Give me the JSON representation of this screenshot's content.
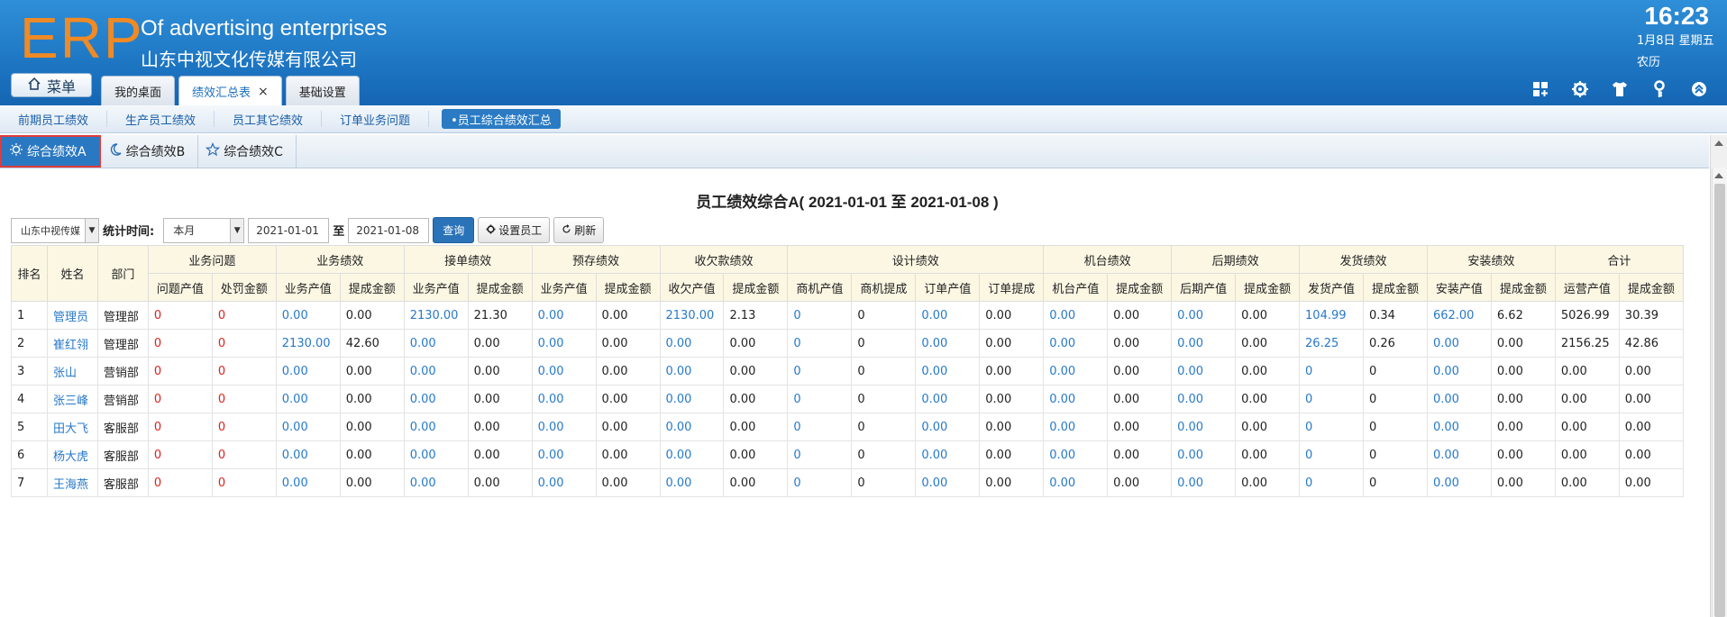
{
  "header": {
    "logo": "ERP",
    "company_en": "Of advertising enterprises",
    "company_cn": "山东中视文化传媒有限公司",
    "time": "16:23",
    "date": "1月8日 星期五",
    "lunar": "农历",
    "menu_label": "菜单",
    "tabs": [
      {
        "label": "我的桌面"
      },
      {
        "label": "绩效汇总表",
        "close": "×"
      },
      {
        "label": "基础设置"
      }
    ]
  },
  "subnav": [
    "前期员工绩效",
    "生产员工绩效",
    "员工其它绩效",
    "订单业务问题",
    "•员工综合绩效汇总"
  ],
  "inner_tabs": [
    "综合绩效A",
    "综合绩效B",
    "综合绩效C"
  ],
  "report": {
    "title": "员工绩效综合A( 2021-01-01 至 2021-01-08 )",
    "company_select": "山东中视传媒",
    "time_label": "统计时间:",
    "period_select": "本月",
    "date_from": "2021-01-01",
    "to_label": "至",
    "date_to": "2021-01-08",
    "query_btn": "查询",
    "set_staff_btn": "设置员工",
    "refresh_btn": "刷新"
  },
  "table": {
    "fixed_headers": [
      "排名",
      "姓名",
      "部门"
    ],
    "groups": [
      {
        "name": "业务问题",
        "cols": [
          "问题产值",
          "处罚金额"
        ]
      },
      {
        "name": "业务绩效",
        "cols": [
          "业务产值",
          "提成金额"
        ]
      },
      {
        "name": "接单绩效",
        "cols": [
          "业务产值",
          "提成金额"
        ]
      },
      {
        "name": "预存绩效",
        "cols": [
          "业务产值",
          "提成金额"
        ]
      },
      {
        "name": "收欠款绩效",
        "cols": [
          "收欠产值",
          "提成金额"
        ]
      },
      {
        "name": "设计绩效",
        "cols": [
          "商机产值",
          "商机提成",
          "订单产值",
          "订单提成"
        ]
      },
      {
        "name": "机台绩效",
        "cols": [
          "机台产值",
          "提成金额"
        ]
      },
      {
        "name": "后期绩效",
        "cols": [
          "后期产值",
          "提成金额"
        ]
      },
      {
        "name": "发货绩效",
        "cols": [
          "发货产值",
          "提成金额"
        ]
      },
      {
        "name": "安装绩效",
        "cols": [
          "安装产值",
          "提成金额"
        ]
      },
      {
        "name": "合计",
        "cols": [
          "运营产值",
          "提成金额"
        ]
      }
    ],
    "rows": [
      [
        "1",
        "管理员",
        "管理部",
        "0",
        "0",
        "0.00",
        "0.00",
        "2130.00",
        "21.30",
        "0.00",
        "0.00",
        "2130.00",
        "2.13",
        "0",
        "0",
        "0.00",
        "0.00",
        "0.00",
        "0.00",
        "0.00",
        "0.00",
        "104.99",
        "0.34",
        "662.00",
        "6.62",
        "5026.99",
        "30.39"
      ],
      [
        "2",
        "崔红翎",
        "管理部",
        "0",
        "0",
        "2130.00",
        "42.60",
        "0.00",
        "0.00",
        "0.00",
        "0.00",
        "0.00",
        "0.00",
        "0",
        "0",
        "0.00",
        "0.00",
        "0.00",
        "0.00",
        "0.00",
        "0.00",
        "26.25",
        "0.26",
        "0.00",
        "0.00",
        "2156.25",
        "42.86"
      ],
      [
        "3",
        "张山",
        "营销部",
        "0",
        "0",
        "0.00",
        "0.00",
        "0.00",
        "0.00",
        "0.00",
        "0.00",
        "0.00",
        "0.00",
        "0",
        "0",
        "0.00",
        "0.00",
        "0.00",
        "0.00",
        "0.00",
        "0.00",
        "0",
        "0",
        "0.00",
        "0.00",
        "0.00",
        "0.00"
      ],
      [
        "4",
        "张三峰",
        "营销部",
        "0",
        "0",
        "0.00",
        "0.00",
        "0.00",
        "0.00",
        "0.00",
        "0.00",
        "0.00",
        "0.00",
        "0",
        "0",
        "0.00",
        "0.00",
        "0.00",
        "0.00",
        "0.00",
        "0.00",
        "0",
        "0",
        "0.00",
        "0.00",
        "0.00",
        "0.00"
      ],
      [
        "5",
        "田大飞",
        "客服部",
        "0",
        "0",
        "0.00",
        "0.00",
        "0.00",
        "0.00",
        "0.00",
        "0.00",
        "0.00",
        "0.00",
        "0",
        "0",
        "0.00",
        "0.00",
        "0.00",
        "0.00",
        "0.00",
        "0.00",
        "0",
        "0",
        "0.00",
        "0.00",
        "0.00",
        "0.00"
      ],
      [
        "6",
        "杨大虎",
        "客服部",
        "0",
        "0",
        "0.00",
        "0.00",
        "0.00",
        "0.00",
        "0.00",
        "0.00",
        "0.00",
        "0.00",
        "0",
        "0",
        "0.00",
        "0.00",
        "0.00",
        "0.00",
        "0.00",
        "0.00",
        "0",
        "0",
        "0.00",
        "0.00",
        "0.00",
        "0.00"
      ],
      [
        "7",
        "王海燕",
        "客服部",
        "0",
        "0",
        "0.00",
        "0.00",
        "0.00",
        "0.00",
        "0.00",
        "0.00",
        "0.00",
        "0.00",
        "0",
        "0",
        "0.00",
        "0.00",
        "0.00",
        "0.00",
        "0.00",
        "0.00",
        "0",
        "0",
        "0.00",
        "0.00",
        "0.00",
        "0.00"
      ]
    ]
  },
  "colors": {
    "header_blue": "#1b72bf",
    "logo_orange": "#f08a24",
    "link_blue": "#2779c9",
    "value_red": "#d9231f",
    "table_header_bg": "#fbf7e3",
    "active_tab_border": "#e03b3b"
  },
  "icons": [
    "home-icon",
    "grid-add-icon",
    "gear-icon",
    "shirt-icon",
    "key-icon",
    "collapse-up-icon",
    "sun-icon",
    "moon-icon",
    "star-icon",
    "refresh-icon"
  ]
}
